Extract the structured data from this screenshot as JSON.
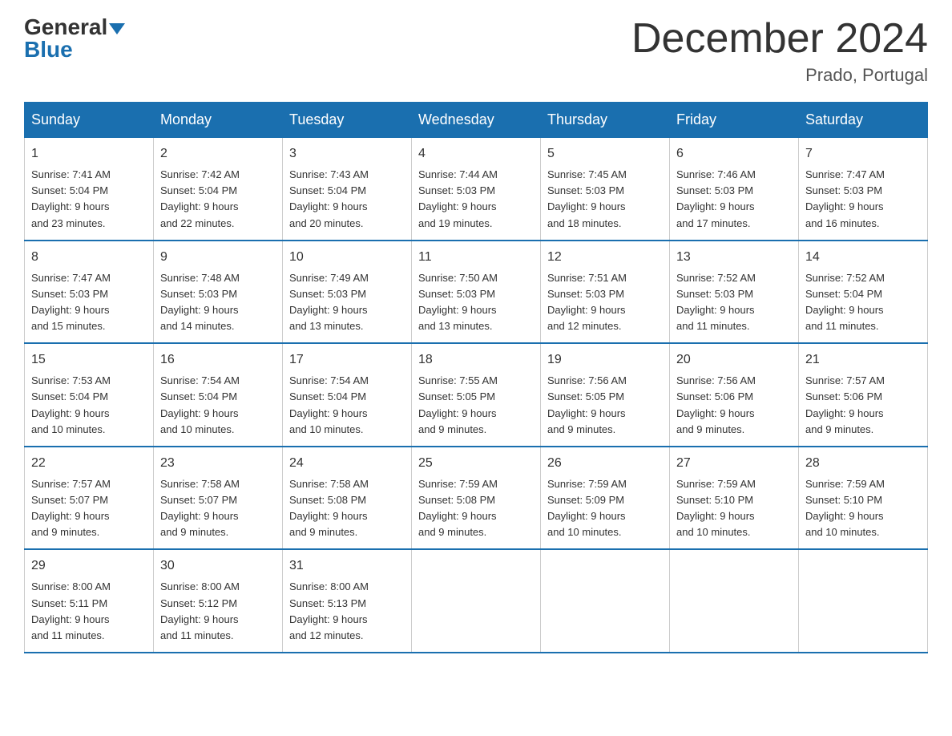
{
  "header": {
    "logo_general": "General",
    "logo_blue": "Blue",
    "month_title": "December 2024",
    "location": "Prado, Portugal"
  },
  "days_of_week": [
    "Sunday",
    "Monday",
    "Tuesday",
    "Wednesday",
    "Thursday",
    "Friday",
    "Saturday"
  ],
  "weeks": [
    [
      {
        "day": "1",
        "sunrise": "7:41 AM",
        "sunset": "5:04 PM",
        "daylight": "9 hours and 23 minutes."
      },
      {
        "day": "2",
        "sunrise": "7:42 AM",
        "sunset": "5:04 PM",
        "daylight": "9 hours and 22 minutes."
      },
      {
        "day": "3",
        "sunrise": "7:43 AM",
        "sunset": "5:04 PM",
        "daylight": "9 hours and 20 minutes."
      },
      {
        "day": "4",
        "sunrise": "7:44 AM",
        "sunset": "5:03 PM",
        "daylight": "9 hours and 19 minutes."
      },
      {
        "day": "5",
        "sunrise": "7:45 AM",
        "sunset": "5:03 PM",
        "daylight": "9 hours and 18 minutes."
      },
      {
        "day": "6",
        "sunrise": "7:46 AM",
        "sunset": "5:03 PM",
        "daylight": "9 hours and 17 minutes."
      },
      {
        "day": "7",
        "sunrise": "7:47 AM",
        "sunset": "5:03 PM",
        "daylight": "9 hours and 16 minutes."
      }
    ],
    [
      {
        "day": "8",
        "sunrise": "7:47 AM",
        "sunset": "5:03 PM",
        "daylight": "9 hours and 15 minutes."
      },
      {
        "day": "9",
        "sunrise": "7:48 AM",
        "sunset": "5:03 PM",
        "daylight": "9 hours and 14 minutes."
      },
      {
        "day": "10",
        "sunrise": "7:49 AM",
        "sunset": "5:03 PM",
        "daylight": "9 hours and 13 minutes."
      },
      {
        "day": "11",
        "sunrise": "7:50 AM",
        "sunset": "5:03 PM",
        "daylight": "9 hours and 13 minutes."
      },
      {
        "day": "12",
        "sunrise": "7:51 AM",
        "sunset": "5:03 PM",
        "daylight": "9 hours and 12 minutes."
      },
      {
        "day": "13",
        "sunrise": "7:52 AM",
        "sunset": "5:03 PM",
        "daylight": "9 hours and 11 minutes."
      },
      {
        "day": "14",
        "sunrise": "7:52 AM",
        "sunset": "5:04 PM",
        "daylight": "9 hours and 11 minutes."
      }
    ],
    [
      {
        "day": "15",
        "sunrise": "7:53 AM",
        "sunset": "5:04 PM",
        "daylight": "9 hours and 10 minutes."
      },
      {
        "day": "16",
        "sunrise": "7:54 AM",
        "sunset": "5:04 PM",
        "daylight": "9 hours and 10 minutes."
      },
      {
        "day": "17",
        "sunrise": "7:54 AM",
        "sunset": "5:04 PM",
        "daylight": "9 hours and 10 minutes."
      },
      {
        "day": "18",
        "sunrise": "7:55 AM",
        "sunset": "5:05 PM",
        "daylight": "9 hours and 9 minutes."
      },
      {
        "day": "19",
        "sunrise": "7:56 AM",
        "sunset": "5:05 PM",
        "daylight": "9 hours and 9 minutes."
      },
      {
        "day": "20",
        "sunrise": "7:56 AM",
        "sunset": "5:06 PM",
        "daylight": "9 hours and 9 minutes."
      },
      {
        "day": "21",
        "sunrise": "7:57 AM",
        "sunset": "5:06 PM",
        "daylight": "9 hours and 9 minutes."
      }
    ],
    [
      {
        "day": "22",
        "sunrise": "7:57 AM",
        "sunset": "5:07 PM",
        "daylight": "9 hours and 9 minutes."
      },
      {
        "day": "23",
        "sunrise": "7:58 AM",
        "sunset": "5:07 PM",
        "daylight": "9 hours and 9 minutes."
      },
      {
        "day": "24",
        "sunrise": "7:58 AM",
        "sunset": "5:08 PM",
        "daylight": "9 hours and 9 minutes."
      },
      {
        "day": "25",
        "sunrise": "7:59 AM",
        "sunset": "5:08 PM",
        "daylight": "9 hours and 9 minutes."
      },
      {
        "day": "26",
        "sunrise": "7:59 AM",
        "sunset": "5:09 PM",
        "daylight": "9 hours and 10 minutes."
      },
      {
        "day": "27",
        "sunrise": "7:59 AM",
        "sunset": "5:10 PM",
        "daylight": "9 hours and 10 minutes."
      },
      {
        "day": "28",
        "sunrise": "7:59 AM",
        "sunset": "5:10 PM",
        "daylight": "9 hours and 10 minutes."
      }
    ],
    [
      {
        "day": "29",
        "sunrise": "8:00 AM",
        "sunset": "5:11 PM",
        "daylight": "9 hours and 11 minutes."
      },
      {
        "day": "30",
        "sunrise": "8:00 AM",
        "sunset": "5:12 PM",
        "daylight": "9 hours and 11 minutes."
      },
      {
        "day": "31",
        "sunrise": "8:00 AM",
        "sunset": "5:13 PM",
        "daylight": "9 hours and 12 minutes."
      },
      null,
      null,
      null,
      null
    ]
  ],
  "labels": {
    "sunrise": "Sunrise:",
    "sunset": "Sunset:",
    "daylight": "Daylight:"
  }
}
